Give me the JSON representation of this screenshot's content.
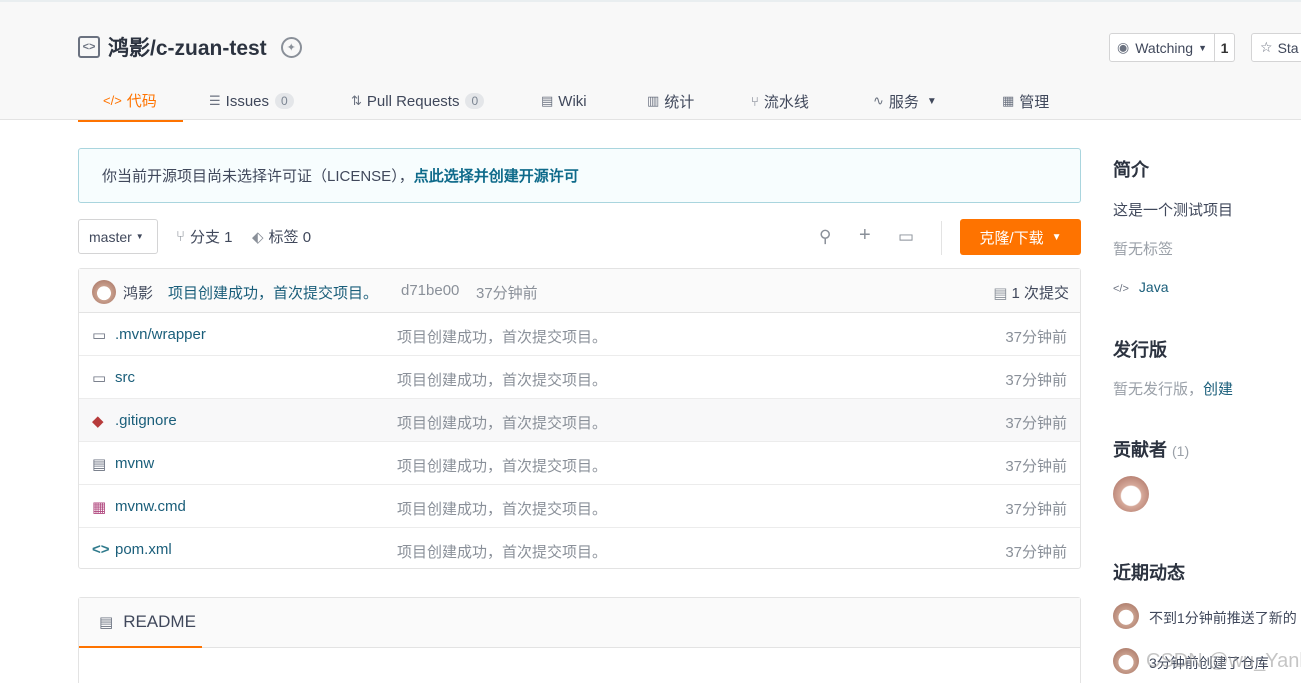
{
  "repo": {
    "title": "鸿影/c-zuan-test"
  },
  "actions": {
    "watch_label": "Watching",
    "watch_count": "1",
    "star_label": "Sta"
  },
  "tabs": [
    {
      "icon": "</>",
      "label": "代码"
    },
    {
      "icon": "☰",
      "label": "Issues",
      "count": "0"
    },
    {
      "icon": "⇅",
      "label": "Pull Requests",
      "count": "0"
    },
    {
      "icon": "▤",
      "label": "Wiki"
    },
    {
      "icon": "▥",
      "label": "统计"
    },
    {
      "icon": "⑂",
      "label": "流水线"
    },
    {
      "icon": "∿",
      "label": "服务"
    },
    {
      "icon": "▦",
      "label": "管理"
    }
  ],
  "license": {
    "text": "你当前开源项目尚未选择许可证（LICENSE），",
    "link": "点此选择并创建开源许可"
  },
  "toolbar": {
    "branch": "master",
    "branches": "分支 1",
    "tags": "标签 0",
    "clone": "克隆/下载"
  },
  "commit": {
    "author": "鸿影",
    "message": "项目创建成功，首次提交项目。",
    "hash": "d71be00",
    "time": "37分钟前",
    "count": "1 次提交"
  },
  "files": [
    {
      "icon": "folder-icon",
      "name": ".mvn/wrapper",
      "message": "项目创建成功，首次提交项目。",
      "time": "37分钟前"
    },
    {
      "icon": "folder-icon",
      "name": "src",
      "message": "项目创建成功，首次提交项目。",
      "time": "37分钟前"
    },
    {
      "icon": "git-icon",
      "name": ".gitignore",
      "message": "项目创建成功，首次提交项目。",
      "time": "37分钟前"
    },
    {
      "icon": "file-icon",
      "name": "mvnw",
      "message": "项目创建成功，首次提交项目。",
      "time": "37分钟前"
    },
    {
      "icon": "windows-icon",
      "name": "mvnw.cmd",
      "message": "项目创建成功，首次提交项目。",
      "time": "37分钟前"
    },
    {
      "icon": "code-icon",
      "name": "pom.xml",
      "message": "项目创建成功，首次提交项目。",
      "time": "37分钟前"
    }
  ],
  "readme": {
    "label": "README"
  },
  "sidebar": {
    "intro_title": "简介",
    "intro_text": "这是一个测试项目",
    "no_tags": "暂无标签",
    "language": "Java",
    "release_title": "发行版",
    "release_text": "暂无发行版，",
    "release_link": "创建",
    "contributors_title": "贡献者",
    "contributors_count": "(1)",
    "activity_title": "近期动态",
    "activity_1": "不到1分钟前推送了新的",
    "activity_2": "3分钟前创建了仓库"
  },
  "watermark": "CSDN @wu_Yank"
}
